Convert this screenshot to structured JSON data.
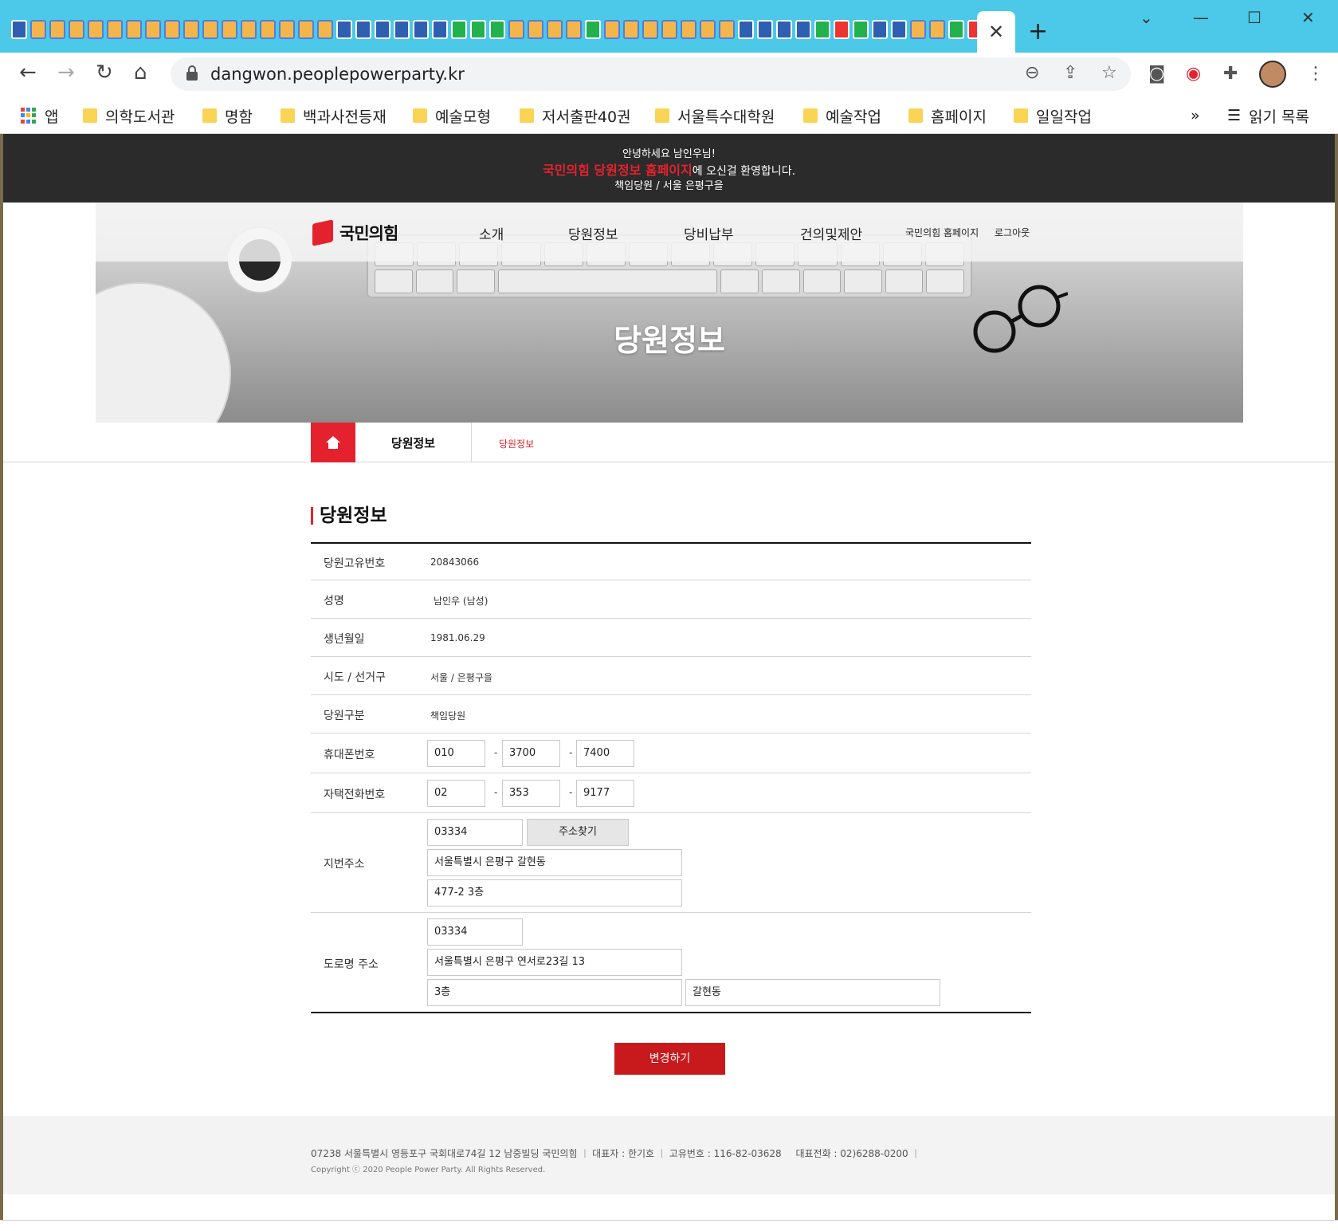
{
  "browser": {
    "url": "dangwon.peoplepowerparty.kr",
    "close_tab_glyph": "✕",
    "new_tab_glyph": "+",
    "more_glyph": "»"
  },
  "bookmarks": {
    "apps_label": "앱",
    "items": [
      "의학도서관",
      "명함",
      "백과사전등재",
      "예술모형",
      "저서출판40권",
      "서울특수대학원",
      "예술작업",
      "홈페이지",
      "일일작업"
    ],
    "reading_list": "읽기 목록"
  },
  "welcome": {
    "line1": "안녕하세요 남인우님!",
    "line2_highlight": "국민의힘 당원정보 홈페이지",
    "line2_rest": "에 오신걸 환영합니다.",
    "line3": "책임당원 / 서울 은평구을"
  },
  "site": {
    "logo_text": "국민의힘",
    "nav": [
      "소개",
      "당원정보",
      "당비납부",
      "건의및제안"
    ],
    "util": [
      "국민의힘 홈페이지",
      "로그아웃"
    ],
    "hero_title": "당원정보"
  },
  "location": {
    "current": "당원정보",
    "sub": "당원정보"
  },
  "form": {
    "section_title": "당원정보",
    "member_id_label": "당원고유번호",
    "member_id": "20843066",
    "name_label": "성명",
    "name": "남인우 (남성)",
    "birth_label": "생년월일",
    "birth": "1981.06.29",
    "district_label": "시도 / 선거구",
    "district": "서울 / 은평구을",
    "type_label": "당원구분",
    "type": "책임당원",
    "mobile_label": "휴대폰번호",
    "mobile": [
      "010",
      "3700",
      "7400"
    ],
    "home_label": "자택전화번호",
    "home": [
      "02",
      "353",
      "9177"
    ],
    "dash": "-",
    "jibun_label": "지번주소",
    "jibun_zip": "03334",
    "find_address": "주소찾기",
    "jibun_addr1": "서울특별시 은평구 갈현동",
    "jibun_addr2": "477-2 3층",
    "road_label": "도로명 주소",
    "road_zip": "03334",
    "road_addr1": "서울특별시 은평구 연서로23길 13",
    "road_addr2": "3층",
    "road_addr3": "갈현동",
    "submit": "변경하기"
  },
  "footer": {
    "address": "07238 서울특별시 영등포구 국회대로74길 12 남중빌딩 국민의힘",
    "ceo": "대표자 : 한기호",
    "bizno": "고유번호 : 116-82-03628",
    "phone": "대표전화 : 02)6288-0200",
    "copyright": "Copyright ⓒ 2020 People Power Party. All Rights Reserved."
  },
  "colors": {
    "tab_strip": "#4cc8e8",
    "brand_red": "#e4222d",
    "submit_red": "#c8191d",
    "topbar": "#2b2b2b"
  }
}
